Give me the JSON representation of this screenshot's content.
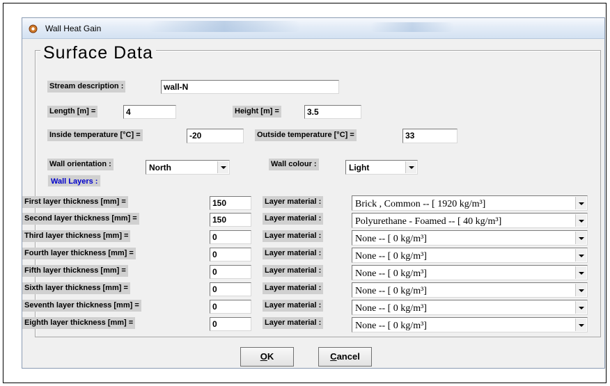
{
  "window": {
    "title": "Wall Heat Gain"
  },
  "group": {
    "title": "Surface Data"
  },
  "fields": {
    "stream_label": "Stream description :",
    "stream_value": "wall-N",
    "length_label": "Length [m] =",
    "length_value": "4",
    "height_label": "Height [m] =",
    "height_value": "3.5",
    "inside_temp_label": "Inside temperature [°C] =",
    "inside_temp_value": "-20",
    "outside_temp_label": "Outside temperature [°C] =",
    "outside_temp_value": "33",
    "orientation_label": "Wall orientation :",
    "orientation_value": "North",
    "colour_label": "Wall colour :",
    "colour_value": "Light"
  },
  "layers_tab": "Wall Layers :",
  "layers": [
    {
      "label": "First layer thickness [mm]  =",
      "value": "150",
      "material_label": "Layer material :",
      "material": "Brick , Common -- [ 1920 kg/m³]"
    },
    {
      "label": "Second layer thickness [mm]  =",
      "value": "150",
      "material_label": "Layer material :",
      "material": "Polyurethane - Foamed -- [ 40 kg/m³]"
    },
    {
      "label": "Third layer thickness [mm]  =",
      "value": "0",
      "material_label": "Layer material :",
      "material": "None -- [ 0 kg/m³]"
    },
    {
      "label": "Fourth layer thickness [mm]  =",
      "value": "0",
      "material_label": "Layer material :",
      "material": "None -- [ 0 kg/m³]"
    },
    {
      "label": "Fifth layer thickness [mm]  =",
      "value": "0",
      "material_label": "Layer material :",
      "material": "None -- [ 0 kg/m³]"
    },
    {
      "label": "Sixth layer thickness [mm]  =",
      "value": "0",
      "material_label": "Layer material :",
      "material": "None -- [ 0 kg/m³]"
    },
    {
      "label": "Seventh layer thickness [mm]  =",
      "value": "0",
      "material_label": "Layer material :",
      "material": "None -- [ 0 kg/m³]"
    },
    {
      "label": "Eighth layer thickness [mm]  =",
      "value": "0",
      "material_label": "Layer material :",
      "material": "None -- [ 0 kg/m³]"
    }
  ],
  "buttons": {
    "ok_mnemonic": "O",
    "ok_rest": "K",
    "cancel_mnemonic": "C",
    "cancel_rest": "ancel"
  },
  "icons": {
    "app": "gear-icon",
    "dropdown": "chevron-down-icon"
  }
}
